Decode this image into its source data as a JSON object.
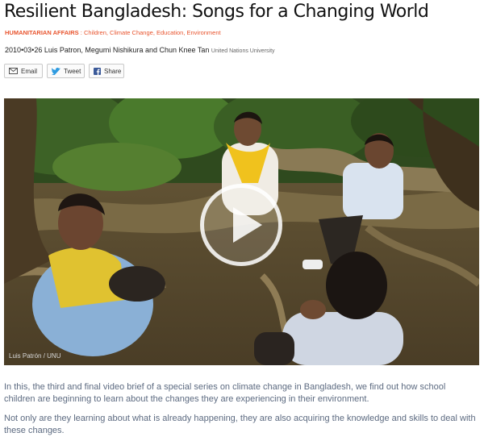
{
  "article": {
    "title": "Resilient Bangladesh: Songs for a Changing World",
    "category_lead": "HUMANITARIAN AFFAIRS",
    "category_sep": " : ",
    "categories": "Children, Climate Change, Education, Environment",
    "date": "2010•03•26",
    "author_1": "Luis Patron",
    "author_2": "Megumi Nishikura",
    "author_joiner": "and",
    "author_3": "Chun Knee Tan",
    "affiliation": "United Nations University"
  },
  "share": {
    "email_label": "Email",
    "tweet_label": "Tweet",
    "facebook_label": "Share",
    "email_icon": "envelope-icon",
    "tweet_icon": "twitter-bird-icon",
    "facebook_icon": "facebook-f-icon"
  },
  "video": {
    "credit": "Luis Patrón / UNU",
    "play_icon": "play-icon"
  },
  "body": {
    "paragraph_1": "In this, the third and final video brief of a special series on climate change in Bangladesh, we find out how school children are beginning to learn about the changes they are experiencing in their environment.",
    "paragraph_2": "Not only are they learning about what is already happening, they are also acquiring the knowledge and skills to deal with these changes."
  },
  "colors": {
    "category": "#e8542e",
    "body_text": "#5c6a80",
    "tweet_blue": "#2f9be0",
    "facebook_blue": "#3b5a99"
  }
}
